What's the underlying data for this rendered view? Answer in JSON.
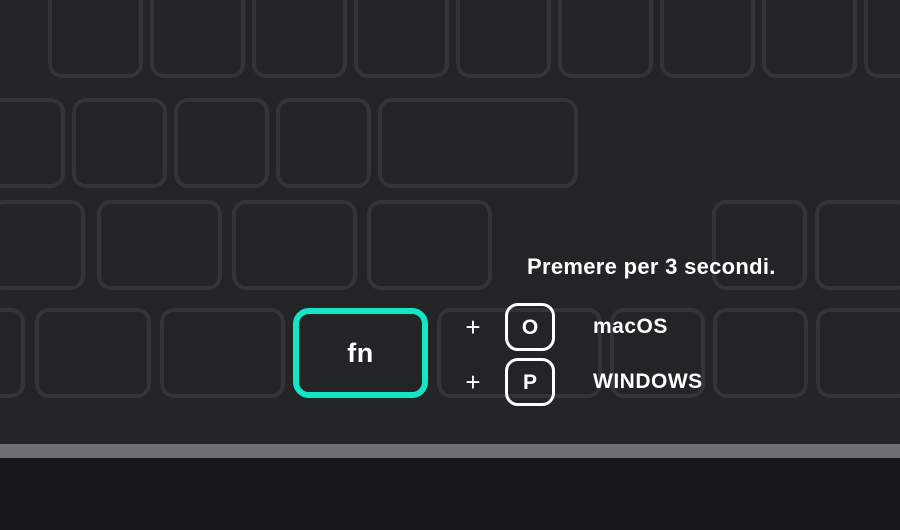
{
  "fn_key": {
    "label": "fn"
  },
  "instruction": "Premere per 3 secondi.",
  "combos": {
    "macos": {
      "plus": "+",
      "key": "O",
      "os": "macOS"
    },
    "windows": {
      "plus": "+",
      "key": "P",
      "os": "WINDOWS"
    }
  },
  "colors": {
    "accent": "#15e4c6"
  }
}
